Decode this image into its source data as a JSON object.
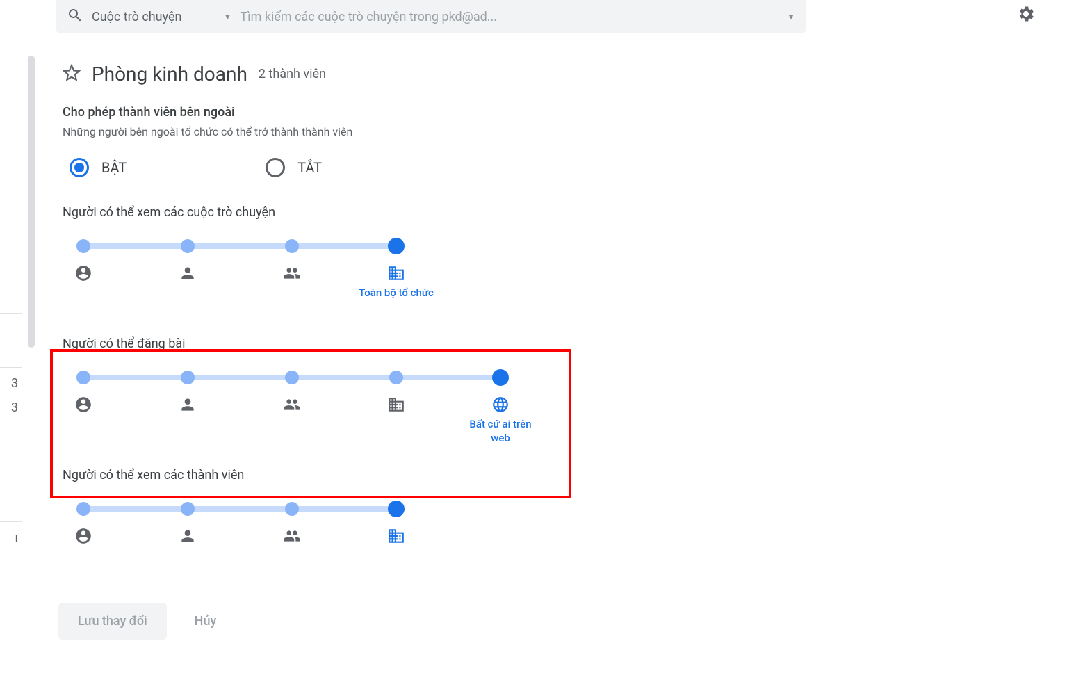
{
  "search": {
    "category": "Cuộc trò chuyện",
    "placeholder": "Tìm kiếm các cuộc trò chuyện trong pkd@ad..."
  },
  "group": {
    "title": "Phòng kinh doanh",
    "member_count": "2 thành viên"
  },
  "external_members": {
    "heading": "Cho phép thành viên bên ngoài",
    "desc": "Những người bên ngoài tổ chức có thể trở thành thành viên",
    "on_label": "BẬT",
    "off_label": "TẮT",
    "value": "on"
  },
  "sliders": {
    "view_conversations": {
      "title": "Người có thể xem các cuộc trò chuyện",
      "selected_index": 3,
      "stops": [
        {
          "icon": "person-circle"
        },
        {
          "icon": "person"
        },
        {
          "icon": "people"
        },
        {
          "icon": "org",
          "label": "Toàn bộ tổ chức"
        }
      ]
    },
    "post": {
      "title": "Người có thể đăng bài",
      "selected_index": 4,
      "stops": [
        {
          "icon": "person-circle"
        },
        {
          "icon": "person"
        },
        {
          "icon": "people"
        },
        {
          "icon": "org"
        },
        {
          "icon": "web",
          "label": "Bất cứ ai trên web"
        }
      ]
    },
    "view_members": {
      "title": "Người có thể xem các thành viên",
      "selected_index": 3,
      "stops": [
        {
          "icon": "person-circle"
        },
        {
          "icon": "person"
        },
        {
          "icon": "people"
        },
        {
          "icon": "org"
        }
      ]
    }
  },
  "left_crumbs": [
    "3",
    "3"
  ],
  "footer": {
    "save": "Lưu thay đổi",
    "cancel": "Hủy"
  }
}
